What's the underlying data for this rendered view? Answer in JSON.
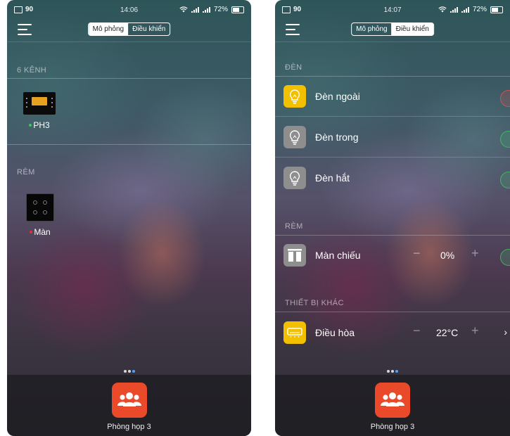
{
  "left": {
    "status": {
      "signal_count": "90",
      "time": "14:06",
      "battery": "72%"
    },
    "mode_tabs": [
      {
        "label": "Mô phỏng",
        "active": true
      },
      {
        "label": "Điều khiển",
        "active": false
      }
    ],
    "sections": [
      {
        "title": "6 KÊNH",
        "devices": [
          {
            "label": "PH3",
            "status_color": "#3cc85a"
          }
        ]
      },
      {
        "title": "RÈM",
        "devices": [
          {
            "label": "Màn",
            "status_color": "#e53030"
          }
        ]
      }
    ],
    "room": {
      "label": "Phòng họp 3"
    }
  },
  "right": {
    "status": {
      "signal_count": "90",
      "time": "14:07",
      "battery": "72%"
    },
    "mode_tabs": [
      {
        "label": "Mô phỏng",
        "active": false
      },
      {
        "label": "Điều khiển",
        "active": true
      }
    ],
    "lights": {
      "title": "ĐÈN",
      "items": [
        {
          "label": "Đèn ngoài",
          "on": true
        },
        {
          "label": "Đèn trong",
          "on": false
        },
        {
          "label": "Đèn hắt",
          "on": false
        }
      ]
    },
    "curtains": {
      "title": "RÈM",
      "items": [
        {
          "label": "Màn chiếu",
          "value": "0%"
        }
      ]
    },
    "other": {
      "title": "THIẾT BỊ KHÁC",
      "items": [
        {
          "label": "Điều hòa",
          "value": "22°C"
        }
      ]
    },
    "room": {
      "label": "Phòng họp 3"
    }
  },
  "colors": {
    "accent_orange": "#ea4a2a",
    "bulb_on": "#f3c000",
    "bulb_off": "#8e8e8e",
    "toggle_on": "#e05555",
    "toggle_off": "#3fbf6a",
    "page_dot_active": "#4aa3ff"
  }
}
